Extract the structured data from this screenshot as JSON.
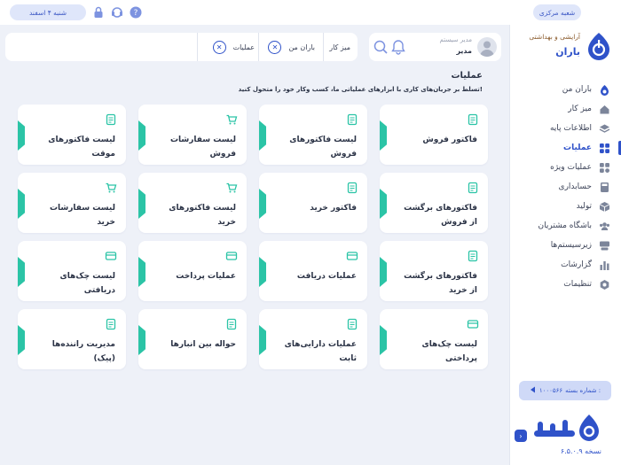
{
  "topbar": {
    "branch": "شعبه مرکزی",
    "date": "شنبه ۴ اسفند",
    "icons": [
      "help-icon",
      "headset-icon",
      "lock-icon"
    ]
  },
  "brand": {
    "subtitle": "آرایشی و بهداشتی",
    "name": "باران"
  },
  "user": {
    "role": "مدیر سیستم",
    "name": "مدیر"
  },
  "tabs": [
    {
      "label": "میز کار"
    },
    {
      "label": "باران من"
    },
    {
      "label": "عملیات"
    }
  ],
  "page": {
    "title": "عملیات",
    "description": "تسلط بر جریان‌های کاری با ابزارهای عملیاتی ما، کسب وکار خود را متحول کنید!"
  },
  "nav": [
    {
      "label": "باران من",
      "icon": "baran-icon"
    },
    {
      "label": "میز کار",
      "icon": "home-icon"
    },
    {
      "label": "اطلاعات پایه",
      "icon": "layers-icon"
    },
    {
      "label": "عملیات",
      "icon": "grid-icon",
      "active": true
    },
    {
      "label": "عملیات ویژه",
      "icon": "star-grid-icon"
    },
    {
      "label": "حسابداری",
      "icon": "calculator-icon"
    },
    {
      "label": "تولید",
      "icon": "box-icon"
    },
    {
      "label": "باشگاه مشتریان",
      "icon": "users-icon"
    },
    {
      "label": "زیرسیستم‌ها",
      "icon": "subsystem-icon"
    },
    {
      "label": "گزارشات",
      "icon": "chart-icon"
    },
    {
      "label": "تنظیمات",
      "icon": "gear-icon"
    }
  ],
  "serial": {
    "label": "شماره بسته :",
    "value": "۱۰۰۰۵۶۶"
  },
  "version": "نسخه ۶.۵.۰.۹",
  "cards": [
    {
      "label": "فاکتور فروش",
      "icon": "invoice-icon"
    },
    {
      "label": "لیست فاکتورهای فروش",
      "icon": "invoice-list-icon"
    },
    {
      "label": "لیست سفارشات فروش",
      "icon": "basket-icon"
    },
    {
      "label": "لیست فاکتورهای موقت",
      "icon": "temp-invoice-icon"
    },
    {
      "label": "فاکتورهای برگشت از فروش",
      "icon": "return-icon"
    },
    {
      "label": "فاکتور خرید",
      "icon": "purchase-invoice-icon"
    },
    {
      "label": "لیست فاکتورهای خرید",
      "icon": "cart-icon"
    },
    {
      "label": "لیست سفارشات خرید",
      "icon": "cart-order-icon"
    },
    {
      "label": "فاکتورهای برگشت از خرید",
      "icon": "return-purchase-icon"
    },
    {
      "label": "عملیات دریافت",
      "icon": "receive-icon"
    },
    {
      "label": "عملیات پرداخت",
      "icon": "payment-icon"
    },
    {
      "label": "لیست چک‌های دریافتی",
      "icon": "check-received-icon"
    },
    {
      "label": "لیست چک‌های پرداختی",
      "icon": "check-paid-icon"
    },
    {
      "label": "عملیات دارایی‌های ثابت",
      "icon": "assets-icon"
    },
    {
      "label": "حواله بین انبارها",
      "icon": "warehouse-icon"
    },
    {
      "label": "مدیریت راننده‌ها (پیک)",
      "icon": "courier-icon"
    }
  ],
  "colors": {
    "accent": "#2f52c9",
    "teal": "#2bc4a6",
    "background": "#eef1f8"
  }
}
